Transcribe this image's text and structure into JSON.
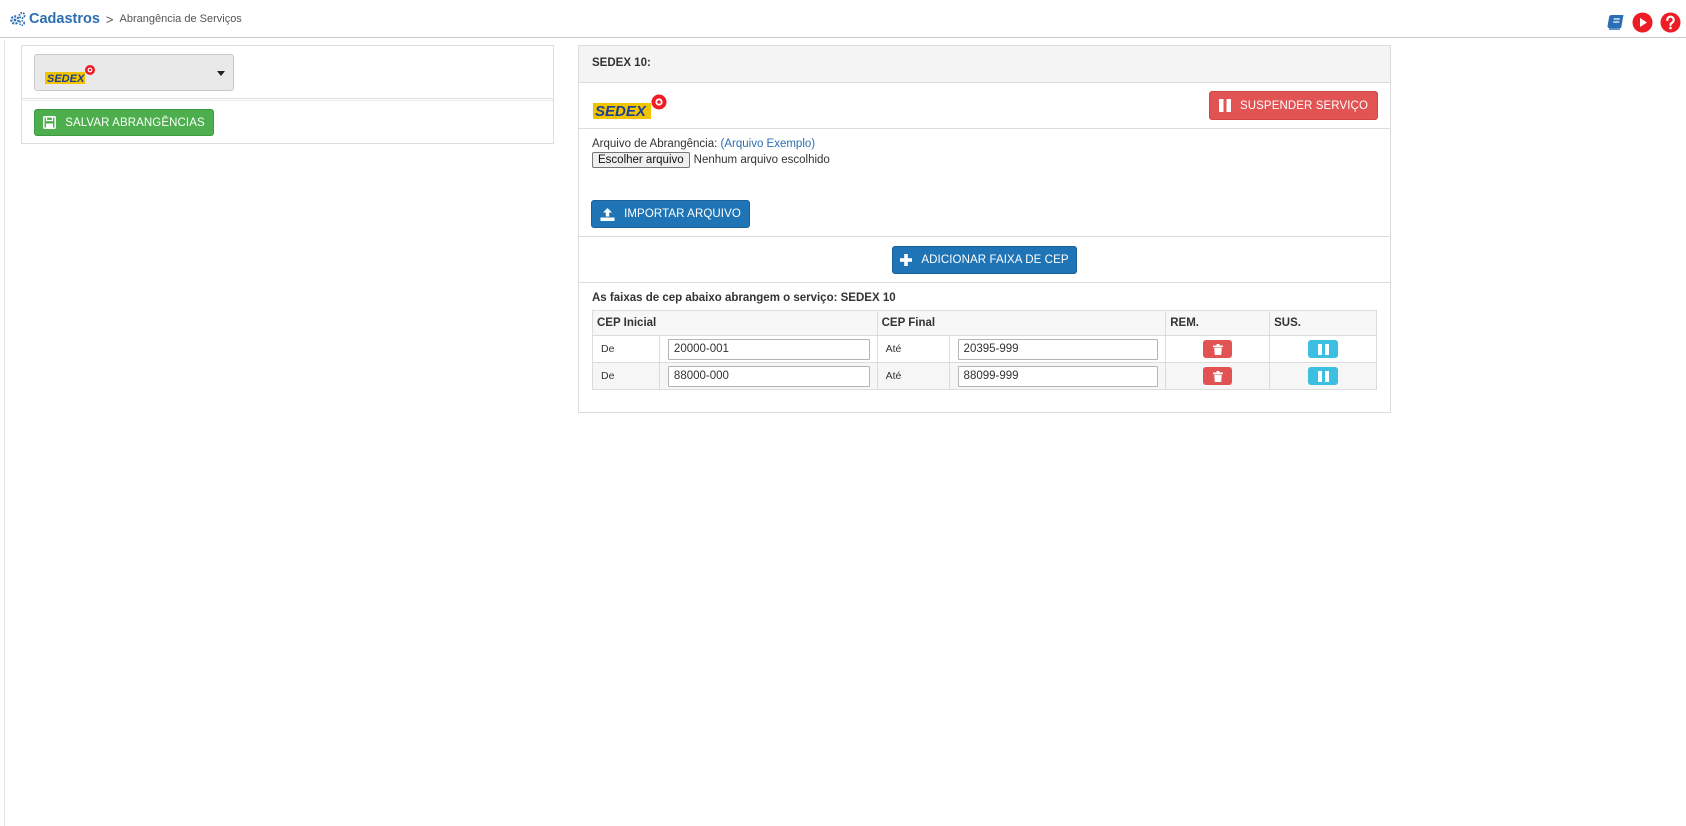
{
  "breadcrumb": {
    "root": "Cadastros",
    "separator": ">",
    "current": "Abrangência de Serviços"
  },
  "header_icons": [
    "manual-book-icon",
    "video-play-icon",
    "help-icon"
  ],
  "left_panel": {
    "service_select": {
      "selected_logo_text": "SEDEX"
    },
    "save_button": "SALVAR ABRANGÊNCIAS"
  },
  "service_panel": {
    "title": "SEDEX 10:",
    "logo_text": "SEDEX",
    "suspend_button": "SUSPENDER SERVIÇO",
    "file_label": "Arquivo de Abrangência:",
    "example_link": "(Arquivo Exemplo)",
    "file_button": "Escolher arquivo",
    "file_status": "Nenhum arquivo escolhido",
    "import_button": "IMPORTAR ARQUIVO",
    "add_button": "ADICIONAR FAIXA DE CEP",
    "ranges_title": "As faixas de cep abaixo abrangem o serviço: SEDEX 10",
    "table": {
      "headers": {
        "cep_inicial": "CEP Inicial",
        "cep_final": "CEP Final",
        "rem": "REM.",
        "sus": "SUS."
      },
      "rows": [
        {
          "de_label": "De",
          "start": "20000-001",
          "ate_label": "Até",
          "end": "20395-999"
        },
        {
          "de_label": "De",
          "start": "88000-000",
          "ate_label": "Até",
          "end": "88099-999"
        }
      ]
    }
  },
  "colors": {
    "primary": "#1f74b5",
    "success": "#4cae4c",
    "danger": "#e25353",
    "info": "#3cbfe0",
    "link": "#2a6fb4"
  }
}
